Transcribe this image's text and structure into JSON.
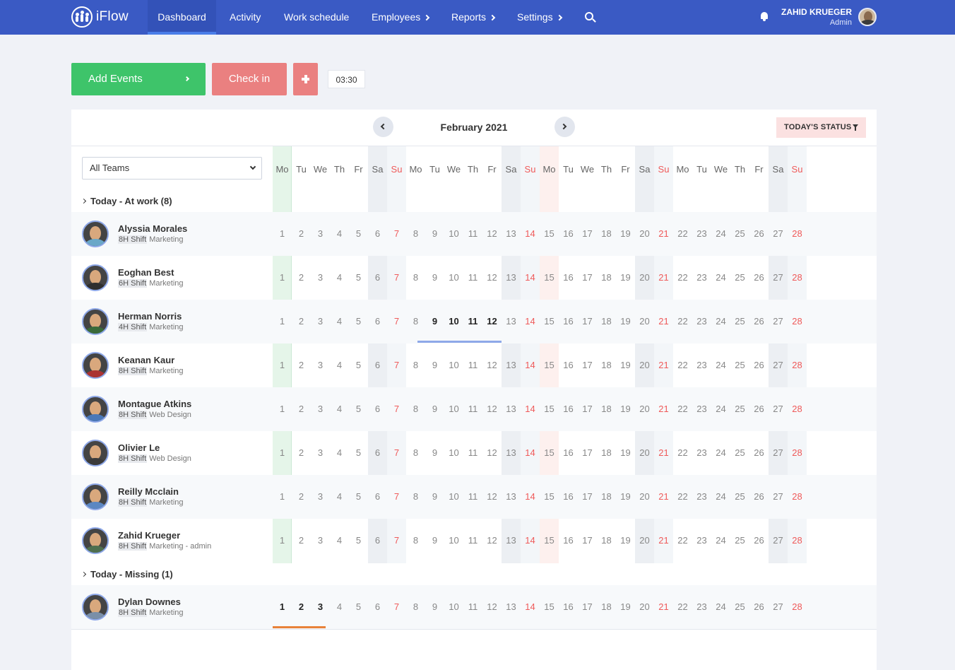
{
  "nav": {
    "logo": "iFlow",
    "items": [
      {
        "label": "Dashboard",
        "active": true
      },
      {
        "label": "Activity"
      },
      {
        "label": "Work schedule"
      },
      {
        "label": "Employees",
        "has_submenu": true
      },
      {
        "label": "Reports",
        "has_submenu": true
      },
      {
        "label": "Settings",
        "has_submenu": true
      }
    ],
    "user_name": "ZAHID KRUEGER",
    "user_role": "Admin"
  },
  "actions": {
    "add_events": "Add Events",
    "check_in": "Check in",
    "timer": "03:30"
  },
  "calendar": {
    "month": "February 2021",
    "status_button": "TODAY'S STATUS",
    "team_filter": "All Teams",
    "weekdays": [
      "Mo",
      "Tu",
      "We",
      "Th",
      "Fr",
      "Sa",
      "Su",
      "Mo",
      "Tu",
      "We",
      "Th",
      "Fr",
      "Sa",
      "Su",
      "Mo",
      "Tu",
      "We",
      "Th",
      "Fr",
      "Sa",
      "Su",
      "Mo",
      "Tu",
      "We",
      "Th",
      "Fr",
      "Sa",
      "Su"
    ],
    "days": [
      1,
      2,
      3,
      4,
      5,
      6,
      7,
      8,
      9,
      10,
      11,
      12,
      13,
      14,
      15,
      16,
      17,
      18,
      19,
      20,
      21,
      22,
      23,
      24,
      25,
      26,
      27,
      28
    ]
  },
  "sections": [
    {
      "label": "Today - At work (8)",
      "employees": [
        {
          "name": "Alyssia Morales",
          "shift": "8H Shift",
          "team": "Marketing"
        },
        {
          "name": "Eoghan Best",
          "shift": "6H Shift",
          "team": "Marketing"
        },
        {
          "name": "Herman Norris",
          "shift": "4H Shift",
          "team": "Marketing",
          "bold_days": [
            9,
            10,
            11,
            12
          ]
        },
        {
          "name": "Keanan Kaur",
          "shift": "8H Shift",
          "team": "Marketing"
        },
        {
          "name": "Montague Atkins",
          "shift": "8H Shift",
          "team": "Web Design"
        },
        {
          "name": "Olivier Le",
          "shift": "8H Shift",
          "team": "Web Design"
        },
        {
          "name": "Reilly Mcclain",
          "shift": "8H Shift",
          "team": "Marketing"
        },
        {
          "name": "Zahid Krueger",
          "shift": "8H Shift",
          "team": "Marketing - admin"
        }
      ]
    },
    {
      "label": "Today - Missing (1)",
      "employees": [
        {
          "name": "Dylan Downes",
          "shift": "8H Shift",
          "team": "Marketing",
          "bold_days": [
            1,
            2,
            3
          ]
        }
      ]
    }
  ],
  "colors": {
    "nav": "#3a5ac4",
    "add": "#3ec46a",
    "checkin": "#ea8080",
    "sunday": "#ef5a5a",
    "herman_bar": "#8ea8e8",
    "dylan_bar": "#e8823a"
  }
}
